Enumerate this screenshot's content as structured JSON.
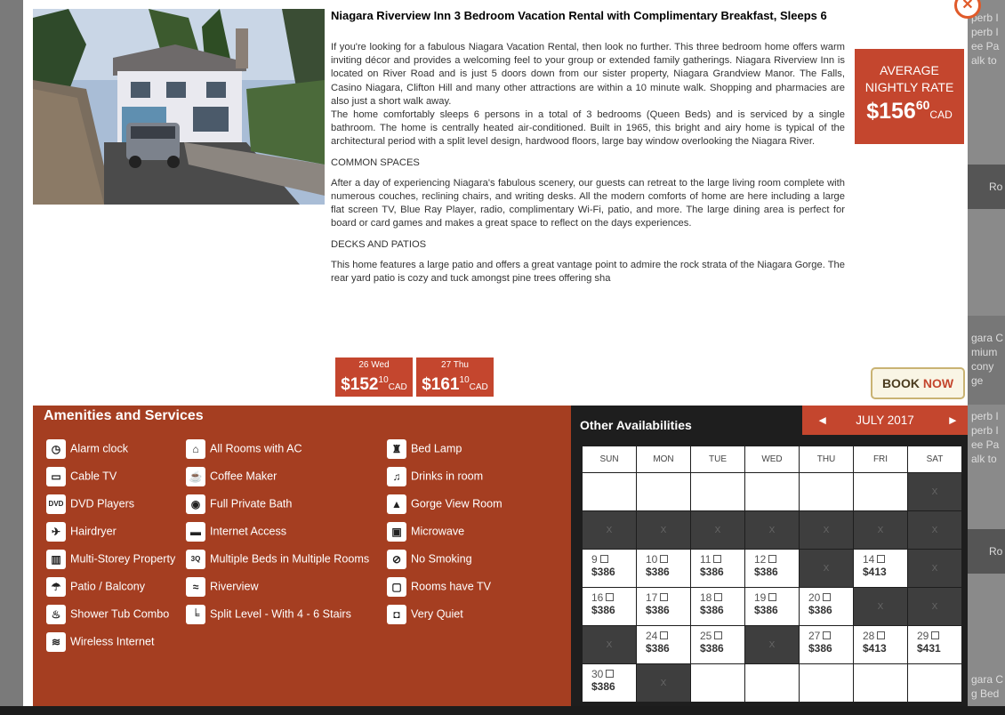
{
  "background": {
    "right_text_top": [
      "perb I",
      "perb I",
      "ee Pa",
      "alk to"
    ],
    "right_link_1": "Ro",
    "right_text_mid": [
      "gara C",
      "mium",
      "cony",
      "ge"
    ],
    "right_text_mid2": [
      "perb I",
      "perb I",
      "ee Pa",
      "alk to"
    ],
    "right_link_2": "Ro",
    "right_text_bottom": [
      "gara C",
      "g Bed"
    ]
  },
  "listing": {
    "title": "Niagara Riverview Inn 3 Bedroom Vacation Rental with Complimentary Breakfast, Sleeps 6",
    "paragraphs": [
      "If you're looking for a fabulous Niagara Vacation Rental, then look no further. This three bedroom home offers warm inviting décor and provides a welcoming feel to your group or extended family gatherings. Niagara Riverview Inn is located on River Road and is just 5 doors down from our sister property, Niagara Grandview Manor. The Falls, Casino Niagara, Clifton Hill and many other attractions are within a 10 minute walk. Shopping and pharmacies are also just a short walk away.\nThe home comfortably sleeps 6 persons in a total of 3 bedrooms (Queen Beds) and is serviced by a single bathroom. The home is centrally heated air-conditioned. Built in 1965, this bright and airy home is typical of the architectural period with a split level design, hardwood floors, large bay window overlooking the Niagara River.",
      "COMMON SPACES",
      "After a day of experiencing Niagara's fabulous scenery, our guests can retreat to the large living room complete with numerous couches, reclining chairs, and writing desks. All the modern comforts of home are here including a large flat screen TV, Blue Ray Player, radio, complimentary Wi-Fi, patio, and more. The large dining area is perfect for board or card games and makes a great space to reflect on the days experiences.",
      "DECKS AND PATIOS",
      "This home features a large patio and offers a great vantage point to admire the rock strata of the Niagara Gorge. The rear yard patio is cozy and tuck amongst pine trees offering sha"
    ]
  },
  "rate": {
    "label_line1": "AVERAGE",
    "label_line2": "NIGHTLY RATE",
    "dollars": "$156",
    "cents": "60",
    "currency": "CAD"
  },
  "date_chips": [
    {
      "day": "26 Wed",
      "dollars": "$152",
      "cents": "10",
      "currency": "CAD"
    },
    {
      "day": "27 Thu",
      "dollars": "$161",
      "cents": "10",
      "currency": "CAD"
    }
  ],
  "book_button": {
    "part1": "BOOK",
    "part2": "NOW"
  },
  "amenities": {
    "title": "Amenities and Services",
    "col1": [
      {
        "label": "Alarm clock",
        "icon": "alarm-clock-icon",
        "glyph": "◷"
      },
      {
        "label": "Cable TV",
        "icon": "tv-icon",
        "glyph": "▭"
      },
      {
        "label": "DVD Players",
        "icon": "dvd-icon",
        "glyph": "DVD"
      },
      {
        "label": "Hairdryer",
        "icon": "hairdryer-icon",
        "glyph": "✈"
      },
      {
        "label": "Multi-Storey Property",
        "icon": "building-icon",
        "glyph": "▥"
      },
      {
        "label": "Patio / Balcony",
        "icon": "patio-icon",
        "glyph": "☂"
      },
      {
        "label": "Shower Tub Combo",
        "icon": "bathtub-icon",
        "glyph": "♨"
      },
      {
        "label": "Wireless Internet",
        "icon": "wifi-icon",
        "glyph": "≋"
      }
    ],
    "col2": [
      {
        "label": "All Rooms with AC",
        "icon": "house-ac-icon",
        "glyph": "⌂"
      },
      {
        "label": "Coffee Maker",
        "icon": "coffee-maker-icon",
        "glyph": "☕"
      },
      {
        "label": "Full Private Bath",
        "icon": "toilet-icon",
        "glyph": "◉"
      },
      {
        "label": "Internet Access",
        "icon": "ethernet-icon",
        "glyph": "▬"
      },
      {
        "label": "Multiple Beds in Multiple Rooms",
        "icon": "multiple-beds-icon",
        "glyph": "3Q"
      },
      {
        "label": "Riverview",
        "icon": "river-icon",
        "glyph": "≈"
      },
      {
        "label": "Split Level - With 4 - 6 Stairs",
        "icon": "stairs-icon",
        "glyph": "╘"
      }
    ],
    "col3": [
      {
        "label": "Bed Lamp",
        "icon": "lamp-icon",
        "glyph": "♜"
      },
      {
        "label": "Drinks in room",
        "icon": "drinks-icon",
        "glyph": "♫"
      },
      {
        "label": "Gorge View Room",
        "icon": "gorge-view-icon",
        "glyph": "▲"
      },
      {
        "label": "Microwave",
        "icon": "microwave-icon",
        "glyph": "▣"
      },
      {
        "label": "No Smoking",
        "icon": "no-smoking-icon",
        "glyph": "⊘"
      },
      {
        "label": "Rooms have TV",
        "icon": "room-tv-icon",
        "glyph": "▢"
      },
      {
        "label": "Very Quiet",
        "icon": "quiet-icon",
        "glyph": "◘"
      }
    ]
  },
  "availability": {
    "title": "Other Availabilities",
    "prev": "◄",
    "next": "►",
    "month": "JULY 2017",
    "days": [
      "SUN",
      "MON",
      "TUE",
      "WED",
      "THU",
      "FRI",
      "SAT"
    ],
    "weeks": [
      [
        {
          "t": "blank"
        },
        {
          "t": "blank"
        },
        {
          "t": "blank"
        },
        {
          "t": "blank"
        },
        {
          "t": "blank"
        },
        {
          "t": "blank"
        },
        {
          "t": "na",
          "label": "X"
        }
      ],
      [
        {
          "t": "na",
          "label": "X"
        },
        {
          "t": "na",
          "label": "X"
        },
        {
          "t": "na",
          "label": "X"
        },
        {
          "t": "na",
          "label": "X"
        },
        {
          "t": "na",
          "label": "X"
        },
        {
          "t": "na",
          "label": "X"
        },
        {
          "t": "na",
          "label": "X"
        }
      ],
      [
        {
          "t": "day",
          "day": "9",
          "price": "$386"
        },
        {
          "t": "day",
          "day": "10",
          "price": "$386"
        },
        {
          "t": "day",
          "day": "11",
          "price": "$386"
        },
        {
          "t": "day",
          "day": "12",
          "price": "$386"
        },
        {
          "t": "na",
          "label": "X"
        },
        {
          "t": "day",
          "day": "14",
          "price": "$413"
        },
        {
          "t": "na",
          "label": "X"
        }
      ],
      [
        {
          "t": "day",
          "day": "16",
          "price": "$386"
        },
        {
          "t": "day",
          "day": "17",
          "price": "$386"
        },
        {
          "t": "day",
          "day": "18",
          "price": "$386"
        },
        {
          "t": "day",
          "day": "19",
          "price": "$386"
        },
        {
          "t": "day",
          "day": "20",
          "price": "$386"
        },
        {
          "t": "na",
          "label": "X"
        },
        {
          "t": "na",
          "label": "X"
        }
      ],
      [
        {
          "t": "na",
          "label": "X"
        },
        {
          "t": "day",
          "day": "24",
          "price": "$386"
        },
        {
          "t": "day",
          "day": "25",
          "price": "$386"
        },
        {
          "t": "na",
          "label": "X"
        },
        {
          "t": "day",
          "day": "27",
          "price": "$386"
        },
        {
          "t": "day",
          "day": "28",
          "price": "$413"
        },
        {
          "t": "day",
          "day": "29",
          "price": "$431"
        }
      ],
      [
        {
          "t": "day",
          "day": "30",
          "price": "$386"
        },
        {
          "t": "na",
          "label": "X"
        },
        {
          "t": "blank"
        },
        {
          "t": "blank"
        },
        {
          "t": "blank"
        },
        {
          "t": "blank"
        },
        {
          "t": "blank"
        }
      ]
    ]
  }
}
